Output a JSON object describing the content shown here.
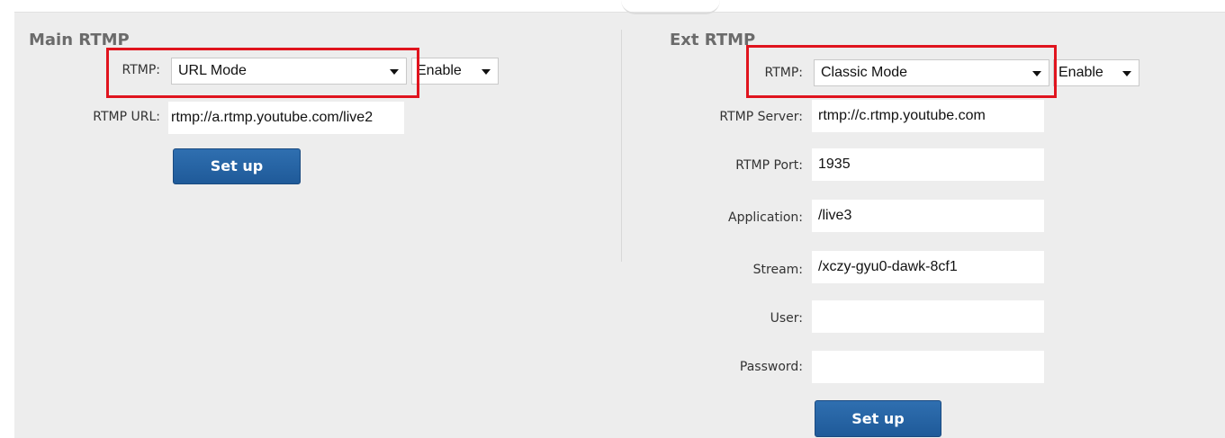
{
  "main": {
    "title": "Main RTMP",
    "rtmp_label": "RTMP:",
    "rtmp_mode": "URL Mode",
    "enable_value": "Enable",
    "url_label": "RTMP URL:",
    "url_value": "rtmp://a.rtmp.youtube.com/live2",
    "setup_label": "Set up"
  },
  "ext": {
    "title": "Ext RTMP",
    "rtmp_label": "RTMP:",
    "rtmp_mode": "Classic Mode",
    "enable_value": "Enable",
    "server_label": "RTMP Server:",
    "server_value": "rtmp://c.rtmp.youtube.com",
    "port_label": "RTMP Port:",
    "port_value": "1935",
    "application_label": "Application:",
    "application_value": "/live3",
    "stream_label": "Stream:",
    "stream_value": "/xczy-gyu0-dawk-8cf1",
    "user_label": "User:",
    "user_value": "",
    "password_label": "Password:",
    "password_value": "",
    "setup_label": "Set up"
  },
  "colors": {
    "highlight": "#e0141e",
    "button": "#2566a6",
    "panel": "#ededed"
  }
}
